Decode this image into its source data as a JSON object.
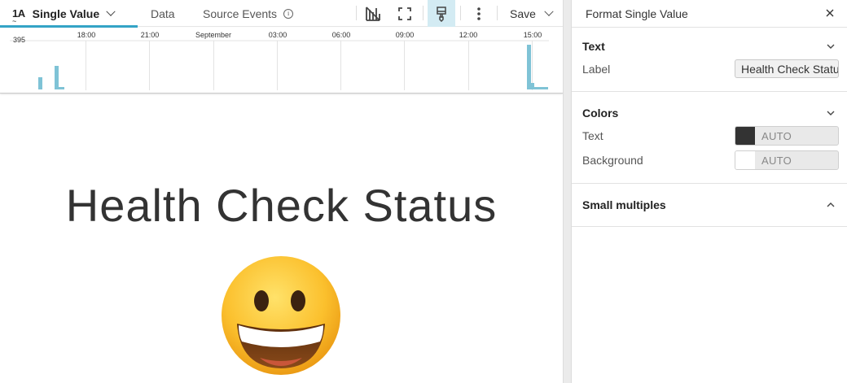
{
  "toolbar": {
    "viz_icon_text": "1A",
    "viz_icon_squiggle": "~",
    "active_tab_label": "Single Value",
    "tab_data_label": "Data",
    "tab_source_label": "Source Events",
    "info_icon_text": "i",
    "save_label": "Save"
  },
  "histogram": {
    "y_max_label": "395",
    "time_labels": [
      "18:00",
      "21:00",
      "September",
      "03:00",
      "06:00",
      "09:00",
      "12:00",
      "15:00"
    ],
    "bar_color": "#7fc3d6"
  },
  "main": {
    "single_value_label": "Health Check Status",
    "emoji_name": "grinning-face"
  },
  "format_panel": {
    "title": "Format Single Value",
    "text_section": {
      "title": "Text",
      "label_field_label": "Label",
      "label_field_value": "Health Check Status"
    },
    "colors_section": {
      "title": "Colors",
      "text_label": "Text",
      "text_color": "#333333",
      "text_value": "AUTO",
      "background_label": "Background",
      "background_color": "#ffffff",
      "background_value": "AUTO"
    },
    "small_multiples_section": {
      "title": "Small multiples"
    }
  },
  "colors": {
    "accent": "#34a4c6",
    "active_tool_bg": "#d3ebf3"
  }
}
